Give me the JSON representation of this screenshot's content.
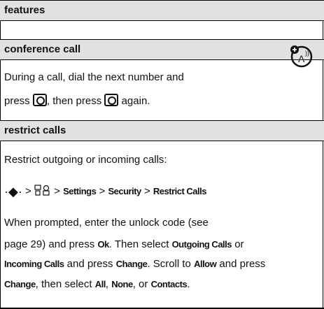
{
  "section": {
    "title": "features"
  },
  "conference": {
    "title": "conference call",
    "line1": "During a call, dial the next number and",
    "line2a": "press",
    "line2b": ", then press",
    "line2c": "again.",
    "badge_icon": "network-feature-icon"
  },
  "restrict": {
    "title": "restrict calls",
    "intro": "Restrict outgoing or incoming calls:",
    "path": {
      "nav_glyph": "·◆·",
      "sep": ">",
      "settings_icon": "settings-icon",
      "settings": "Settings",
      "security": "Security",
      "restrict_calls": "Restrict Calls"
    },
    "p1": "When prompted, enter the unlock code (see",
    "p2a": "page 29) and press",
    "p2_ok": "Ok",
    "p2b": ". Then select",
    "p2_out": "Outgoing Calls",
    "p2c": "or",
    "p3_in": "Incoming Calls",
    "p3a": "and press",
    "p3_change": "Change",
    "p3b": ". Scroll to",
    "p3_allow": "Allow",
    "p3c": "and press",
    "p4_change": "Change",
    "p4a": ", then select",
    "p4_all": "All",
    "p4_none": "None",
    "p4b": ", or",
    "p4_contacts": "Contacts",
    "p4c": "."
  }
}
